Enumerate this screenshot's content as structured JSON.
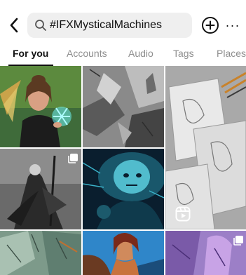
{
  "search": {
    "query": "#IFXMysticalMachines"
  },
  "header": {
    "back_icon": "chevron-left-icon",
    "add_icon": "plus-circle-icon",
    "more_icon": "ellipsis-icon",
    "more_label": "···"
  },
  "tabs": [
    {
      "label": "For you",
      "active": true
    },
    {
      "label": "Accounts",
      "active": false
    },
    {
      "label": "Audio",
      "active": false
    },
    {
      "label": "Tags",
      "active": false
    },
    {
      "label": "Places",
      "active": false
    }
  ],
  "grid": {
    "tiles": [
      {
        "name": "post-sorceress-portrait",
        "badge": null
      },
      {
        "name": "post-gray-sketch",
        "badge": null
      },
      {
        "name": "post-sketch-papers-reel",
        "badge": "reel-icon"
      },
      {
        "name": "post-wizard-staff",
        "badge": "carousel-icon"
      },
      {
        "name": "post-teal-face",
        "badge": null
      },
      {
        "name": "post-teal-sketch",
        "badge": null
      },
      {
        "name": "post-warrior-woman",
        "badge": null
      },
      {
        "name": "post-purple-figure",
        "badge": "carousel-icon"
      }
    ]
  },
  "colors": {
    "accent": "#111111",
    "muted": "#8e8e8e",
    "search_bg": "#efefef"
  }
}
